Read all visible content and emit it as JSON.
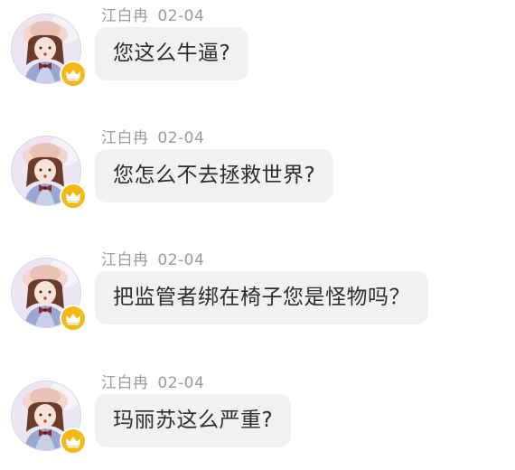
{
  "messages": [
    {
      "username": "江白冉",
      "date": "02-04",
      "text": "您这么牛逼?"
    },
    {
      "username": "江白冉",
      "date": "02-04",
      "text": "您怎么不去拯救世界?"
    },
    {
      "username": "江白冉",
      "date": "02-04",
      "text": "把监管者绑在椅子您是怪物吗？"
    },
    {
      "username": "江白冉",
      "date": "02-04",
      "text": "玛丽苏这么严重?"
    }
  ],
  "icons": {
    "avatar": "user-avatar-icon",
    "badge": "crown-badge-icon"
  },
  "colors": {
    "bubble": "#f1f1f3",
    "meta_text": "#9b9b9b",
    "message_text": "#2d2d2d",
    "badge": "#f5b915"
  }
}
